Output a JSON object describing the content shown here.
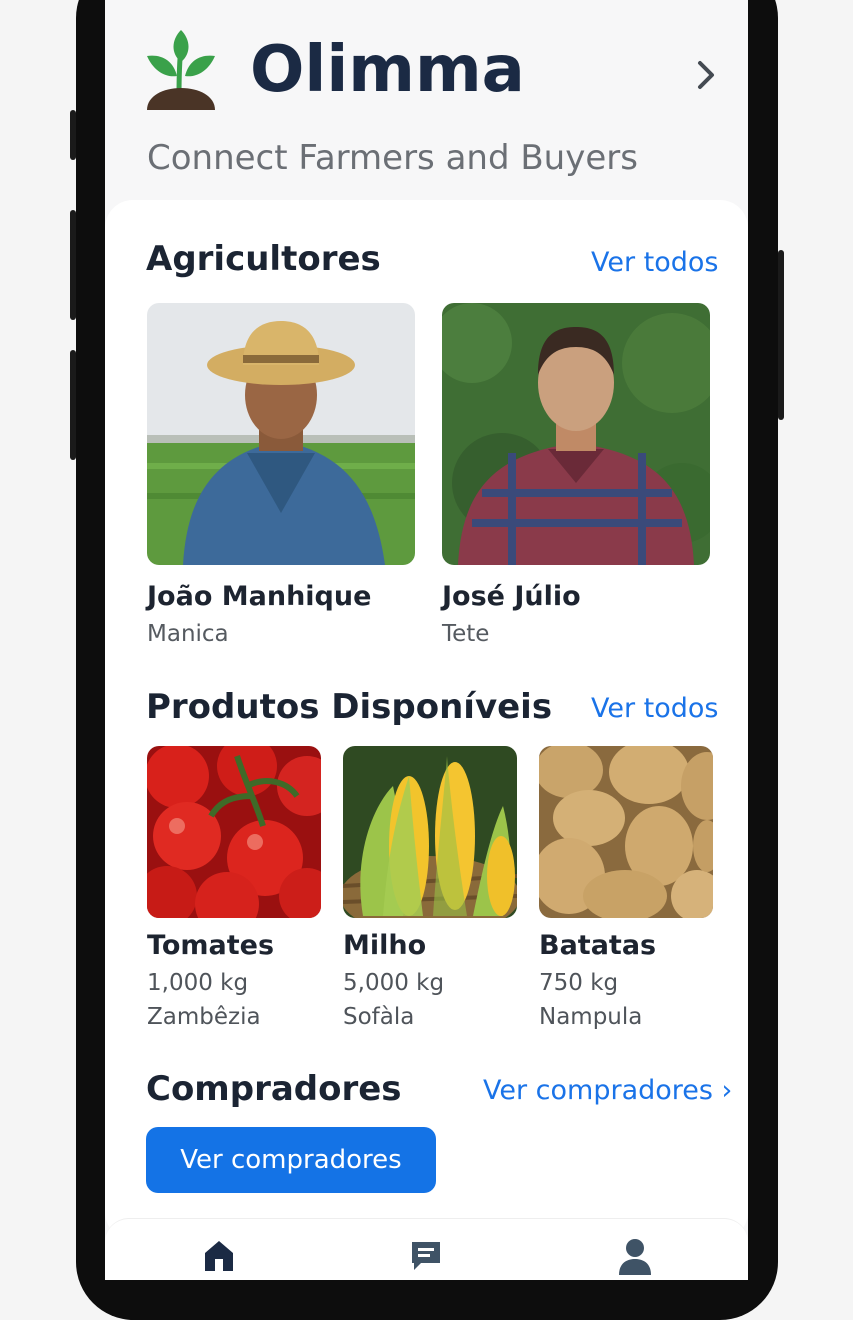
{
  "header": {
    "app_name": "Olimma",
    "tagline": "Connect Farmers and Buyers",
    "logo_icon": "sprout-icon",
    "nav_icon": "chevron-right-icon"
  },
  "farmers": {
    "title": "Agricultores",
    "see_all": "Ver todos",
    "items": [
      {
        "name": "João Manhique",
        "location": "Manica"
      },
      {
        "name": "José Júlio",
        "location": "Tete"
      }
    ]
  },
  "products": {
    "title": "Produtos Disponíveis",
    "see_all": "Ver todos",
    "items": [
      {
        "name": "Tomates",
        "quantity": "1,000 kg",
        "location": "Zambêzia"
      },
      {
        "name": "Milho",
        "quantity": "5,000 kg",
        "location": "Sofàla"
      },
      {
        "name": "Batatas",
        "quantity": "750 kg",
        "location": "Nampula"
      }
    ]
  },
  "buyers": {
    "title": "Compradores",
    "link": "Ver compradores ›",
    "button": "Ver compradores"
  },
  "tabbar": {
    "items": [
      {
        "icon": "home-icon",
        "active": true
      },
      {
        "icon": "message-icon",
        "active": false
      },
      {
        "icon": "profile-icon",
        "active": false
      }
    ]
  },
  "colors": {
    "accent": "#1a73e8",
    "button": "#1473e6",
    "title": "#1b2a44",
    "logo_green": "#3aa14a",
    "soil": "#4a3426"
  }
}
